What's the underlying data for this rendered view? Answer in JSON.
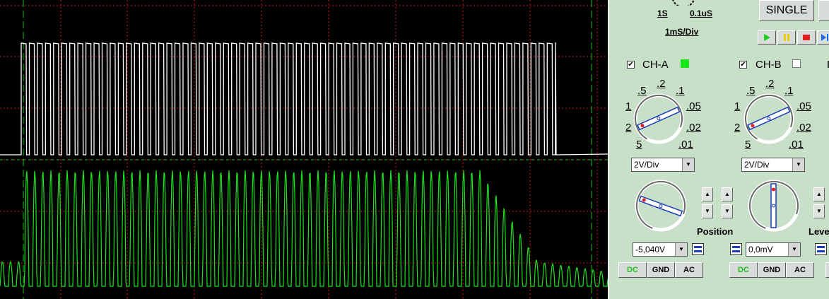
{
  "timebase": {
    "slow_label": "1S",
    "fast_label": "0.1uS",
    "value": "1mS/Div"
  },
  "controls": {
    "single_label": "SINGLE"
  },
  "channel_a": {
    "name": "CH-A",
    "color": "#19e619",
    "checked": true,
    "scale_marks": [
      ".5",
      ".2",
      ".1",
      "1",
      ".05",
      "2",
      ".02",
      "5",
      ".01"
    ],
    "volts_div": "2V/Div",
    "offset": "-5,040V",
    "coupling": [
      "DC",
      "GND",
      "AC"
    ],
    "active_coupling": "DC"
  },
  "channel_b": {
    "name": "CH-B",
    "color": "#ffffff",
    "checked": true,
    "scale_marks": [
      ".5",
      ".2",
      ".1",
      "1",
      ".05",
      "2",
      ".02",
      "5",
      ".01"
    ],
    "volts_div": "2V/Div",
    "offset": "0,0mV",
    "coupling": [
      "DC",
      "GND",
      "AC"
    ],
    "active_coupling": "DC"
  },
  "labels": {
    "position": "Position",
    "level": "Level"
  },
  "glyphs": {
    "check": "✔",
    "dropdown": "▼",
    "up": "▲",
    "down": "▼"
  }
}
